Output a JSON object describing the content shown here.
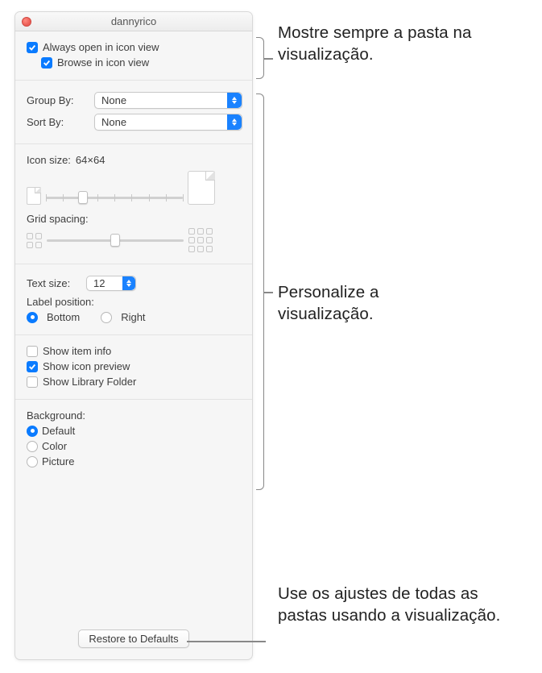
{
  "window": {
    "title": "dannyrico"
  },
  "top": {
    "always_open": {
      "label": "Always open in icon view",
      "checked": true
    },
    "browse": {
      "label": "Browse in icon view",
      "checked": true
    }
  },
  "sort": {
    "group_by_label": "Group By:",
    "group_by_value": "None",
    "sort_by_label": "Sort By:",
    "sort_by_value": "None"
  },
  "icon": {
    "size_label": "Icon size:",
    "size_value": "64×64",
    "grid_label": "Grid spacing:"
  },
  "text": {
    "size_label": "Text size:",
    "size_value": "12",
    "label_position_label": "Label position:",
    "bottom_label": "Bottom",
    "right_label": "Right"
  },
  "show": {
    "info": "Show item info",
    "preview": "Show icon preview",
    "library": "Show Library Folder"
  },
  "bg": {
    "heading": "Background:",
    "default": "Default",
    "color": "Color",
    "picture": "Picture"
  },
  "footer": {
    "restore": "Restore to Defaults"
  },
  "callouts": {
    "top": "Mostre sempre a pasta na visualização.",
    "mid": "Personalize a visualização.",
    "bottom": "Use os ajustes de todas as pastas usando a visualização."
  }
}
